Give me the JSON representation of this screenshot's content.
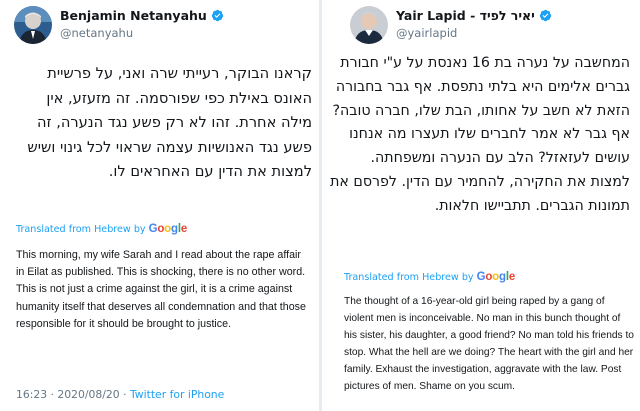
{
  "left_tweet": {
    "display_name": "Benjamin Netanyahu",
    "handle": "@netanyahu",
    "hebrew_text": "קראנו הבוקר, רעייתי שרה ואני, על פרשיית האונס באילת כפי שפורסמה. זה מזעזע, אין מילה אחרת. זהו לא רק פשע נגד הנערה, זה פשע נגד האנושיות עצמה שראוי לכל גינוי ושיש למצות את הדין עם האחראים לו.",
    "translated_from": "Translated from Hebrew by",
    "translator": "Google",
    "english_text": "This morning, my wife Sarah and I read about the rape affair in Eilat as published. This is shocking, there is no other word. This is not just a crime against the girl, it is a crime against humanity itself that deserves all condemnation and that those responsible for it should be brought to justice.",
    "time": "16:23",
    "date": "2020/08/20",
    "source": "Twitter for iPhone",
    "meta_separator": " · "
  },
  "right_tweet": {
    "display_name": "Yair Lapid - יאיר לפיד",
    "handle": "@yairlapid",
    "hebrew_text": "המחשבה על נערה בת 16 נאנסת על ע\"י חבורת גברים אלימים היא בלתי נתפסת. אף גבר בחבורה הזאת לא חשב על אחותו, הבת שלו, חברה טובה? אף גבר לא אמר לחברים שלו תעצרו מה אנחנו עושים לעזאזל? הלב עם הנערה ומשפחתה. למצות את החקירה, להחמיר עם הדין. לפרסם את תמונות הגברים. תתביישו חלאות.",
    "translated_from": "Translated from Hebrew by",
    "translator": "Google",
    "english_text": "The thought of a 16-year-old girl being raped by a gang of violent men is inconceivable. No man in this bunch thought of his sister, his daughter, a good friend? No man told his friends to stop. What the hell are we doing? The heart with the girl and her family. Exhaust the investigation, aggravate with the law. Post pictures of men. Shame on you scum."
  },
  "colors": {
    "twitter_blue": "#1da1f2",
    "secondary_text": "#657786",
    "primary_text": "#14171a"
  },
  "icons": {
    "verified": "verified-badge-icon"
  }
}
